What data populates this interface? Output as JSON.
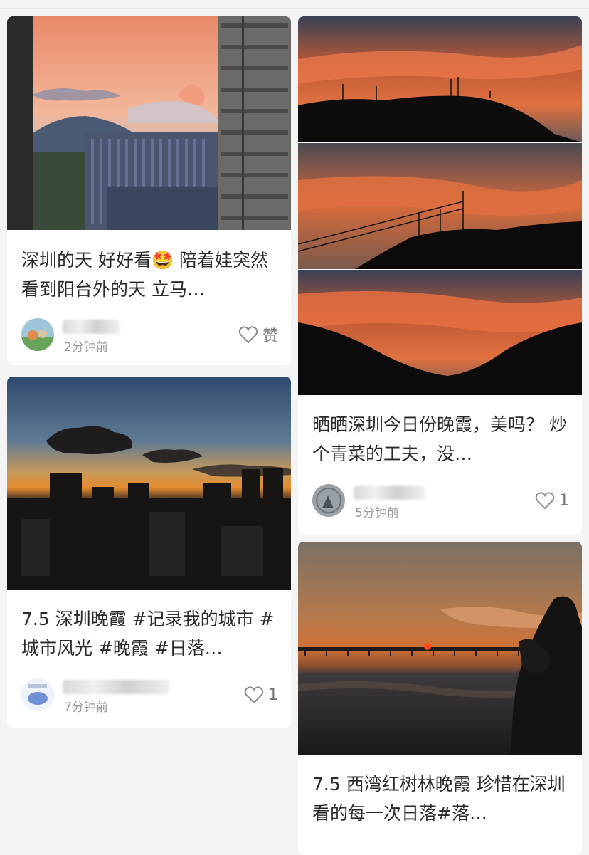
{
  "feed": {
    "posts": [
      {
        "title": "深圳的天 好好看🤩 陪着娃突然看到阳台外的天 立马…",
        "time": "2分钟前",
        "like_label": "赞"
      },
      {
        "title": "晒晒深圳今日份晚霞，美吗？ 炒个青菜的工夫，没…",
        "time": "5分钟前",
        "like_label": "1"
      },
      {
        "title": "7.5 深圳晚霞 #记录我的城市 #城市风光  #晚霞  #日落…",
        "time": "7分钟前",
        "like_label": "1"
      },
      {
        "title": "7.5 西湾红树林晚霞 珍惜在深圳看的每一次日落#落…",
        "time": "",
        "like_label": ""
      }
    ]
  },
  "colors": {
    "background": "#f4f4f4",
    "card": "#ffffff",
    "meta_text": "#9a9a9a",
    "title_text": "#2a2a2a"
  },
  "icons": {
    "like": "heart-outline-icon"
  }
}
